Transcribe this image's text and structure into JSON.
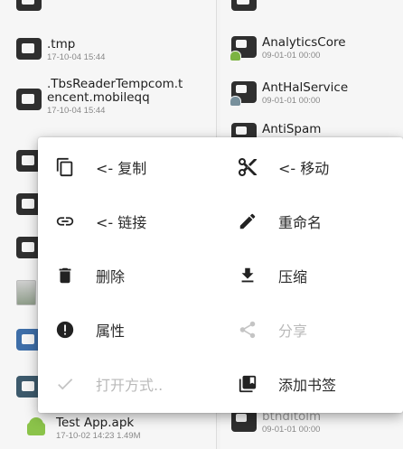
{
  "left_pane": {
    "items": [
      {
        "name": ".tmp",
        "meta": "17-10-04 15:44"
      },
      {
        "name": ".TbsReaderTempcom.t",
        "name2": "encent.mobileqq",
        "meta": "17-10-04 15:44"
      },
      {
        "name": "Test App.apk",
        "meta": "17-10-02 14:23  1.49M"
      }
    ]
  },
  "right_pane": {
    "items": [
      {
        "name": "AnalyticsCore",
        "meta": "09-01-01 00:00"
      },
      {
        "name": "AntHalService",
        "meta": "09-01-01 00:00"
      },
      {
        "name": "AntiSpam",
        "meta": ""
      },
      {
        "name": "btnditolm",
        "meta": "09-01-01 00:00"
      }
    ]
  },
  "menu": {
    "copy": "<- 复制",
    "move": "<- 移动",
    "link": "<- 链接",
    "rename": "重命名",
    "delete": "删除",
    "compress": "压缩",
    "properties": "属性",
    "share": "分享",
    "open_with": "打开方式..",
    "bookmark": "添加书签"
  },
  "colors": {
    "accent_green": "#8bc34a",
    "menu_bg": "#ffffff",
    "disabled_text": "#b9b9b9"
  }
}
